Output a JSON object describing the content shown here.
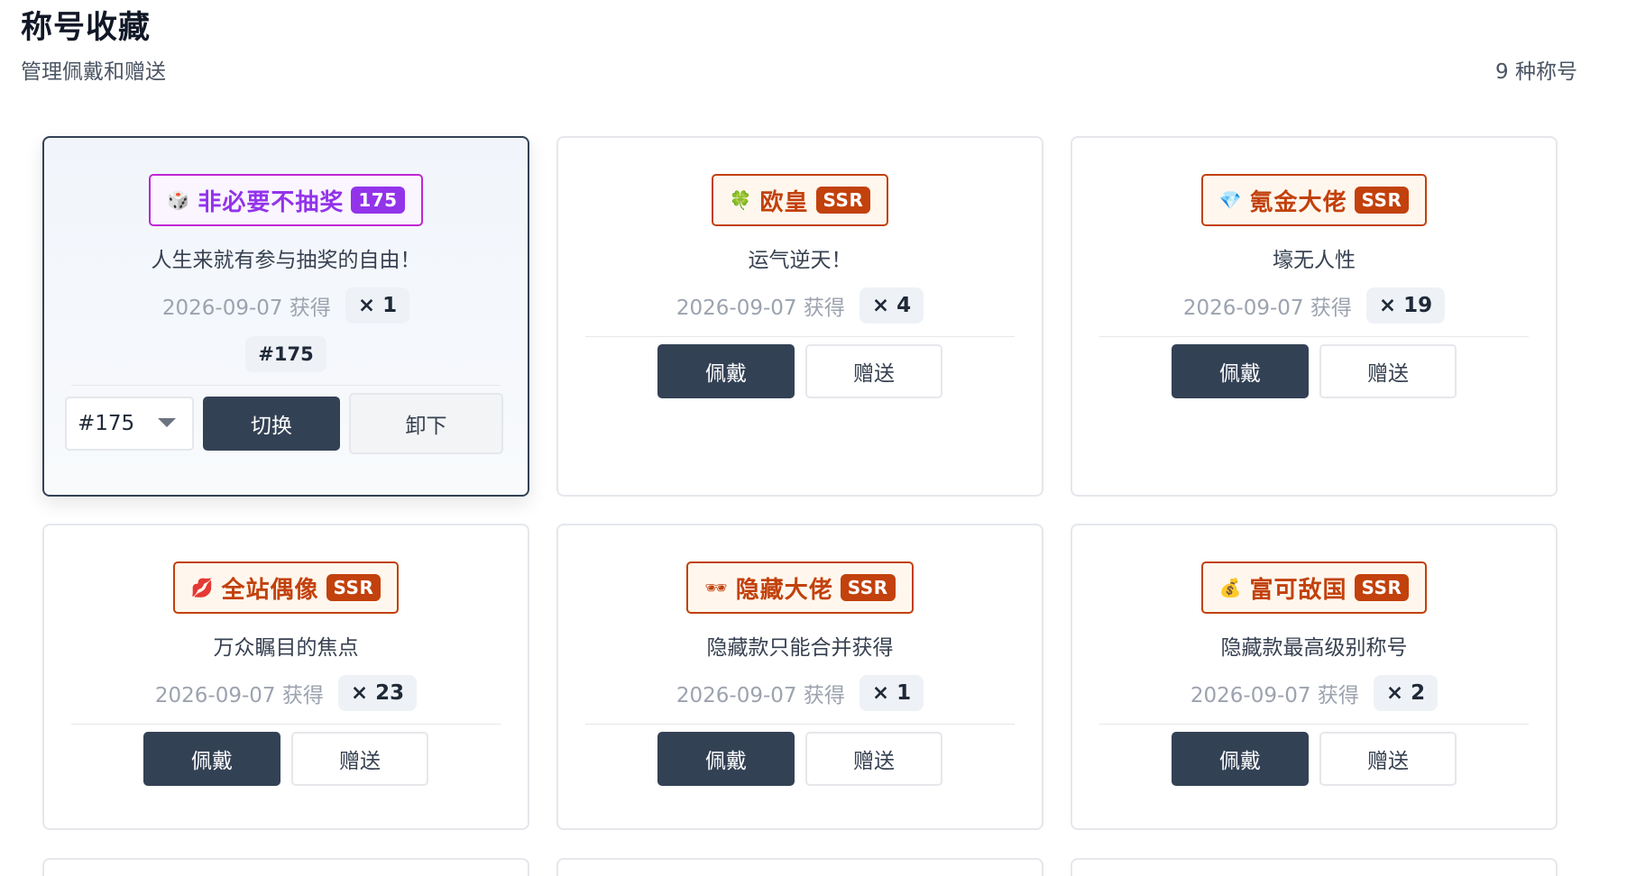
{
  "header": {
    "title": "称号收藏",
    "subtitle": "管理佩戴和赠送",
    "count": "9 种称号"
  },
  "actions": {
    "wear": "佩戴",
    "gift": "赠送",
    "switch": "切换",
    "unequip": "卸下"
  },
  "colors": {
    "ssr_accent": "#c2410c",
    "special_accent": "#9333ea",
    "dark_button": "#334155"
  },
  "cards": [
    {
      "emoji": "🎲",
      "emoji_icon": "dice-icon",
      "name": "非必要不抽奖",
      "tier": "175",
      "desc": "人生来就有参与抽奖的自由！",
      "date": "2026-09-07 获得",
      "count": "× 1",
      "serial": "#175",
      "select_value": "#175",
      "equipped": true
    },
    {
      "emoji": "🍀",
      "emoji_icon": "clover-icon",
      "name": "欧皇",
      "tier": "SSR",
      "desc": "运气逆天！",
      "date": "2026-09-07 获得",
      "count": "× 4"
    },
    {
      "emoji": "💎",
      "emoji_icon": "diamond-icon",
      "name": "氪金大佬",
      "tier": "SSR",
      "desc": "壕无人性",
      "date": "2026-09-07 获得",
      "count": "× 19"
    },
    {
      "emoji": "💋",
      "emoji_icon": "lips-icon",
      "name": "全站偶像",
      "tier": "SSR",
      "desc": "万众瞩目的焦点",
      "date": "2026-09-07 获得",
      "count": "× 23"
    },
    {
      "emoji": "🕶",
      "emoji_icon": "sunglasses-icon",
      "name": "隐藏大佬",
      "tier": "SSR",
      "desc": "隐藏款只能合并获得",
      "date": "2026-09-07 获得",
      "count": "× 1"
    },
    {
      "emoji": "💰",
      "emoji_icon": "money-bag-icon",
      "name": "富可敌国",
      "tier": "SSR",
      "desc": "隐藏款最高级别称号",
      "date": "2026-09-07 获得",
      "count": "× 2"
    }
  ]
}
